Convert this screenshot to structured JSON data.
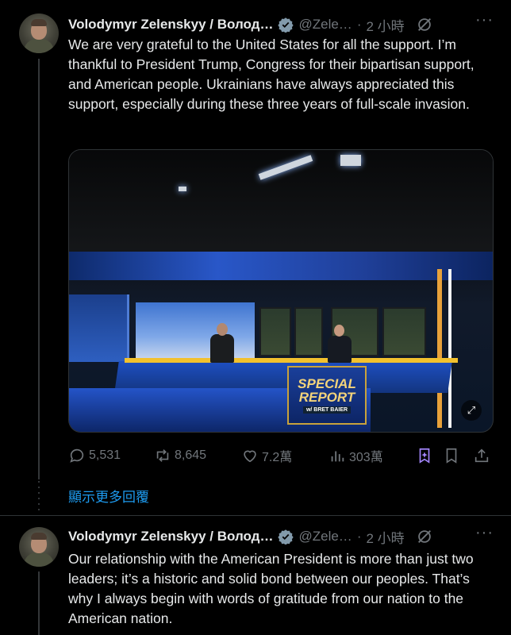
{
  "tweets": [
    {
      "author": "Volodymyr Zelenskyy / Волод…",
      "handle": "@Zele…",
      "separator": "·",
      "time": "2 小時",
      "text": "We are very grateful to the United States for all the support. I’m thankful to President Trump, Congress for their bipartisan support, and American people. Ukrainians have always appreciated this support, especially during these three years of full-scale invasion.",
      "media": {
        "panel_title_line1": "SPECIAL",
        "panel_title_line2": "REPORT",
        "panel_subtitle": "w/ BRET BAIER"
      },
      "actions": {
        "replies": "5,531",
        "reposts": "8,645",
        "likes": "7.2萬",
        "views": "303萬"
      },
      "more": "···"
    },
    {
      "author": "Volodymyr Zelenskyy / Волод…",
      "handle": "@Zele…",
      "separator": "·",
      "time": "2 小時",
      "text": "Our relationship with the American President is more than just two leaders; it’s a historic and solid bond between our peoples. That’s why I always begin with words of gratitude from our nation to the American nation.",
      "more": "···"
    }
  ],
  "show_more_replies": "顯示更多回覆",
  "colors": {
    "background": "#000000",
    "text": "#e7e9ea",
    "muted": "#71767b",
    "link": "#1d9bf0",
    "verified": "#829aab",
    "grok": "#a587ff"
  },
  "icons": [
    "verified-badge-icon",
    "grok-icon",
    "more-icon",
    "reply-icon",
    "repost-icon",
    "like-icon",
    "views-icon",
    "grok-summary-icon",
    "bookmark-icon",
    "share-icon",
    "expand-icon"
  ]
}
